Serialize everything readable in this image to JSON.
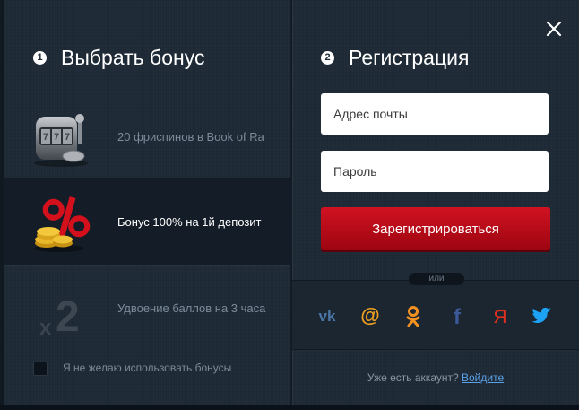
{
  "left": {
    "step": "1",
    "title": "Выбрать бонус",
    "bonuses": [
      {
        "label": "20 фриспинов в Book of Ra",
        "icon": "slot-machine-icon",
        "selected": false
      },
      {
        "label": "Бонус 100% на 1й депозит",
        "icon": "percent-coins-icon",
        "selected": true
      },
      {
        "label": "Удвоение баллов на 3 часа",
        "icon": "x2-icon",
        "selected": false
      }
    ],
    "optout_label": "Я не желаю использовать бонусы"
  },
  "right": {
    "step": "2",
    "title": "Регистрация",
    "email_placeholder": "Адрес почты",
    "password_placeholder": "Пароль",
    "register_label": "Зарегистрироваться",
    "or_label": "или",
    "social": [
      "vk-icon",
      "mail-ru-icon",
      "odnoklassniki-icon",
      "facebook-icon",
      "yandex-icon",
      "twitter-icon"
    ],
    "footer_text": "Уже есть аккаунт?",
    "login_link": "Войдите"
  },
  "colors": {
    "accent_red": "#c20d1b",
    "link_blue": "#5aa0e6",
    "panel_bg": "#1e2a36",
    "vk": "#4a76a8",
    "mail": "#f0a020",
    "ok": "#f29221",
    "facebook": "#3b5998",
    "yandex": "#e0301e",
    "twitter": "#1da1f2"
  },
  "close_icon": "close-icon"
}
